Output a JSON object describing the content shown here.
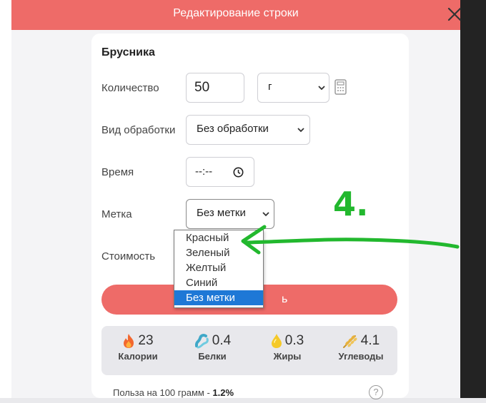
{
  "dialog": {
    "title": "Редактирование строки",
    "close_icon": "close-icon"
  },
  "product": {
    "name": "Брусника"
  },
  "form": {
    "quantity": {
      "label": "Количество",
      "value": "50",
      "unit": "г",
      "calculator_icon": "calculator-icon"
    },
    "processing": {
      "label": "Вид обработки",
      "value": "Без обработки"
    },
    "time": {
      "label": "Время",
      "value": "--:--",
      "clock_icon": "clock-icon"
    },
    "tag": {
      "label": "Метка",
      "value": "Без метки",
      "options": [
        "Красный",
        "Зеленый",
        "Желтый",
        "Синий",
        "Без метки"
      ],
      "selected_index": 4
    },
    "cost": {
      "label": "Стоимость"
    }
  },
  "save_button": {
    "label": "ь"
  },
  "nutrition": [
    {
      "icon": "fire-icon",
      "value": "23",
      "label": "Калории"
    },
    {
      "icon": "protein-icon",
      "value": "0.4",
      "label": "Белки"
    },
    {
      "icon": "drop-icon",
      "value": "0.3",
      "label": "Жиры"
    },
    {
      "icon": "wheat-icon",
      "value": "4.1",
      "label": "Углеводы"
    }
  ],
  "benefit": {
    "text": "Польза на 100 грамм - ",
    "value": "1.2%",
    "help_icon": "help-icon"
  },
  "annotation": {
    "text": "4.",
    "color": "#22b82e"
  },
  "colors": {
    "accent": "#ee6b68",
    "selection": "#1e78d6"
  }
}
